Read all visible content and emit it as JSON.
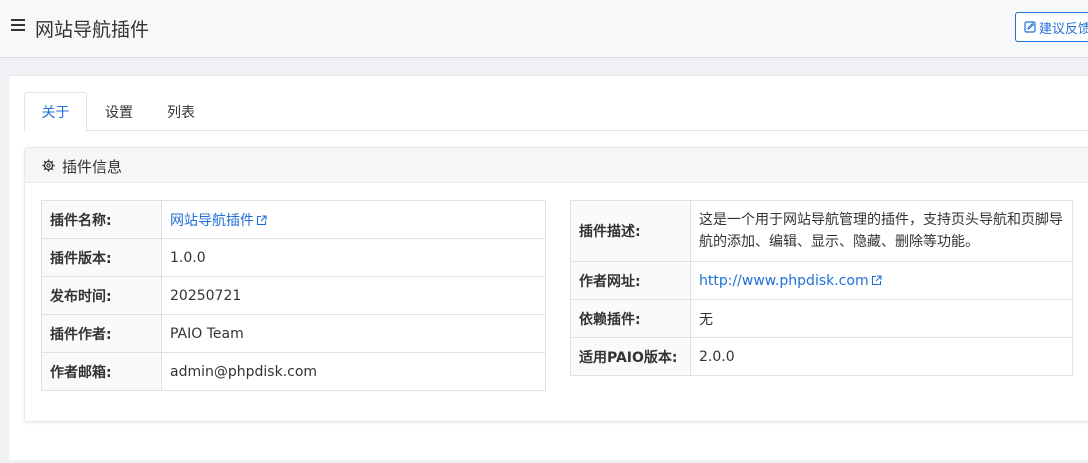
{
  "header": {
    "title": "网站导航插件",
    "feedback_label": "建议反馈"
  },
  "tabs": [
    {
      "label": "关于",
      "active": true
    },
    {
      "label": "设置",
      "active": false
    },
    {
      "label": "列表",
      "active": false
    }
  ],
  "panel": {
    "title": "插件信息"
  },
  "info_left": [
    {
      "key": "插件名称:",
      "value": "网站导航插件",
      "link": true
    },
    {
      "key": "插件版本:",
      "value": "1.0.0"
    },
    {
      "key": "发布时间:",
      "value": "20250721"
    },
    {
      "key": "插件作者:",
      "value": "PAIO Team"
    },
    {
      "key": "作者邮箱:",
      "value": "admin@phpdisk.com"
    }
  ],
  "info_right": [
    {
      "key": "插件描述:",
      "value": "这是一个用于网站导航管理的插件，支持页头导航和页脚导航的添加、编辑、显示、隐藏、删除等功能。"
    },
    {
      "key": "作者网址:",
      "value": "http://www.phpdisk.com",
      "link": true
    },
    {
      "key": "依赖插件:",
      "value": "无"
    },
    {
      "key": "适用PAIO版本:",
      "value": "2.0.0"
    }
  ],
  "colors": {
    "accent": "#1f6fd6",
    "background": "#f0f1f5"
  }
}
